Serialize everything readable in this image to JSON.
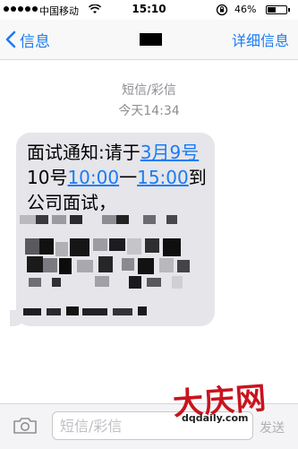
{
  "status_bar": {
    "carrier": "中国移动",
    "time": "15:10",
    "battery_percent": "46%",
    "battery_level": 0.46
  },
  "nav": {
    "back_label": "信息",
    "detail_label": "详细信息"
  },
  "conversation": {
    "message_type": "短信/彩信",
    "timestamp": "今天14:34"
  },
  "message": {
    "text_1": "面试通知:请于",
    "link_date": "3月9号",
    "text_2": "10号",
    "link_time_start": "10:00",
    "text_3": "一",
    "link_time_end": "15:00",
    "text_4": "到公司面试，"
  },
  "input_bar": {
    "placeholder": "短信/彩信",
    "send_label": "发送"
  },
  "watermark": {
    "logo": "大庆网",
    "url": "dqdaily.com"
  },
  "colors": {
    "accent": "#1a7cf5",
    "bubble": "#e5e5ea",
    "watermark_red": "#c8141e"
  }
}
